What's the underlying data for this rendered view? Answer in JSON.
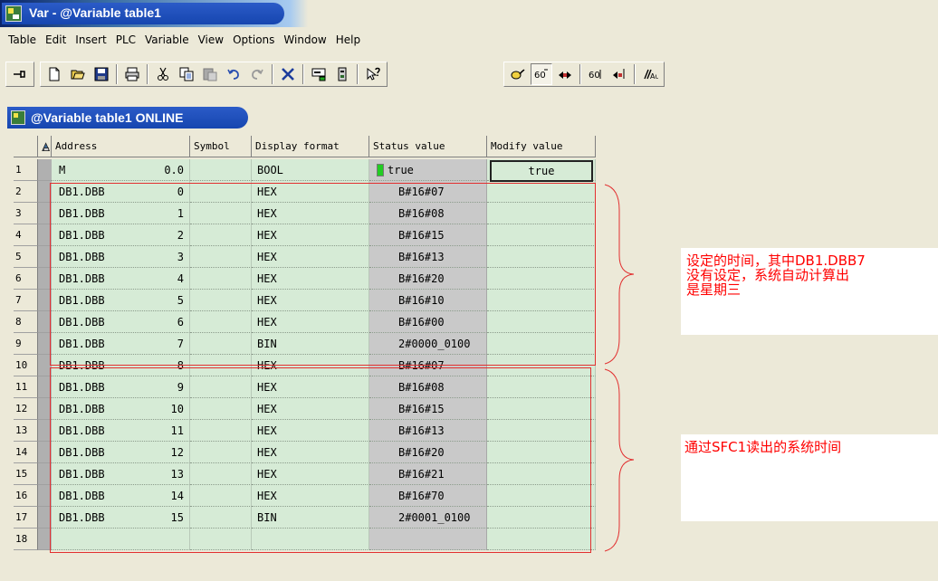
{
  "window": {
    "title": "Var - @Variable table1",
    "icon": "simatic-app-icon"
  },
  "menu": [
    "Table",
    "Edit",
    "Insert",
    "PLC",
    "Variable",
    "View",
    "Options",
    "Window",
    "Help"
  ],
  "toolbar": {
    "icons": [
      "pin-icon",
      "new-icon",
      "open-icon",
      "save-icon",
      "print-icon",
      "cut-icon",
      "copy-icon",
      "paste-icon",
      "undo-icon",
      "redo-icon",
      "delete-icon",
      "monitor-icon",
      "accessible-node-icon",
      "help-pointer-icon",
      "monitor-variable-icon",
      "monitor-variable-pressed-icon",
      "modify-variable-icon",
      "update-values-icon",
      "activate-modify-icon",
      "enable-peripheral-icon"
    ]
  },
  "child_window": {
    "title": "@Variable table1  ONLINE"
  },
  "table": {
    "headers": [
      "Address",
      "Symbol",
      "Display format",
      "Status value",
      "Modify value"
    ],
    "rows": [
      {
        "num": "1",
        "addr": "M",
        "offset": "0.0",
        "symbol": "",
        "format": "BOOL",
        "status": "true",
        "modify": "true"
      },
      {
        "num": "2",
        "addr": "DB1.DBB",
        "offset": "0",
        "symbol": "",
        "format": "HEX",
        "status": "B#16#07",
        "modify": ""
      },
      {
        "num": "3",
        "addr": "DB1.DBB",
        "offset": "1",
        "symbol": "",
        "format": "HEX",
        "status": "B#16#08",
        "modify": ""
      },
      {
        "num": "4",
        "addr": "DB1.DBB",
        "offset": "2",
        "symbol": "",
        "format": "HEX",
        "status": "B#16#15",
        "modify": ""
      },
      {
        "num": "5",
        "addr": "DB1.DBB",
        "offset": "3",
        "symbol": "",
        "format": "HEX",
        "status": "B#16#13",
        "modify": ""
      },
      {
        "num": "6",
        "addr": "DB1.DBB",
        "offset": "4",
        "symbol": "",
        "format": "HEX",
        "status": "B#16#20",
        "modify": ""
      },
      {
        "num": "7",
        "addr": "DB1.DBB",
        "offset": "5",
        "symbol": "",
        "format": "HEX",
        "status": "B#16#10",
        "modify": ""
      },
      {
        "num": "8",
        "addr": "DB1.DBB",
        "offset": "6",
        "symbol": "",
        "format": "HEX",
        "status": "B#16#00",
        "modify": ""
      },
      {
        "num": "9",
        "addr": "DB1.DBB",
        "offset": "7",
        "symbol": "",
        "format": "BIN",
        "status": "2#0000_0100",
        "modify": ""
      },
      {
        "num": "10",
        "addr": "DB1.DBB",
        "offset": "8",
        "symbol": "",
        "format": "HEX",
        "status": "B#16#07",
        "modify": ""
      },
      {
        "num": "11",
        "addr": "DB1.DBB",
        "offset": "9",
        "symbol": "",
        "format": "HEX",
        "status": "B#16#08",
        "modify": ""
      },
      {
        "num": "12",
        "addr": "DB1.DBB",
        "offset": "10",
        "symbol": "",
        "format": "HEX",
        "status": "B#16#15",
        "modify": ""
      },
      {
        "num": "13",
        "addr": "DB1.DBB",
        "offset": "11",
        "symbol": "",
        "format": "HEX",
        "status": "B#16#13",
        "modify": ""
      },
      {
        "num": "14",
        "addr": "DB1.DBB",
        "offset": "12",
        "symbol": "",
        "format": "HEX",
        "status": "B#16#20",
        "modify": ""
      },
      {
        "num": "15",
        "addr": "DB1.DBB",
        "offset": "13",
        "symbol": "",
        "format": "HEX",
        "status": "B#16#21",
        "modify": ""
      },
      {
        "num": "16",
        "addr": "DB1.DBB",
        "offset": "14",
        "symbol": "",
        "format": "HEX",
        "status": "B#16#70",
        "modify": ""
      },
      {
        "num": "17",
        "addr": "DB1.DBB",
        "offset": "15",
        "symbol": "",
        "format": "BIN",
        "status": "2#0001_0100",
        "modify": ""
      },
      {
        "num": "18",
        "addr": "",
        "offset": "",
        "symbol": "",
        "format": "",
        "status": "",
        "modify": ""
      }
    ]
  },
  "annotations": {
    "group1": {
      "lines": [
        "设定的时间，其中DB1.DBB7",
        "没有设定，系统自动计算出",
        "是星期三"
      ]
    },
    "group2": {
      "lines": [
        "通过SFC1读出的系统时间"
      ]
    }
  },
  "colors": {
    "cell_green": "#D6EBD6",
    "status_gray": "#C9C9C9",
    "annotation_red": "#FF0000",
    "title_blue": "#1646B0"
  }
}
